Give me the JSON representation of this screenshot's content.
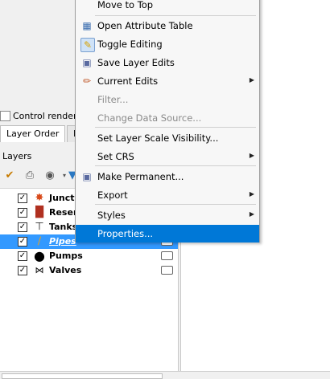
{
  "layers_panel": {
    "control_rendering_label": "Control renderin",
    "tabs": [
      {
        "label": "Layer Order"
      },
      {
        "label": "I"
      }
    ],
    "title": "Layers",
    "layers": [
      {
        "name": "Junct",
        "checked": true,
        "icon": "junction-icon",
        "selected": false
      },
      {
        "name": "Reser",
        "checked": true,
        "icon": "reservoir-icon",
        "selected": false
      },
      {
        "name": "Tanks",
        "checked": true,
        "icon": "tank-icon",
        "selected": false
      },
      {
        "name": "Pipes",
        "checked": true,
        "icon": "pipe-icon",
        "selected": true
      },
      {
        "name": "Pumps",
        "checked": true,
        "icon": "pump-icon",
        "selected": false
      },
      {
        "name": "Valves",
        "checked": true,
        "icon": "valve-icon",
        "selected": false
      }
    ]
  },
  "context_menu": {
    "items": [
      {
        "label": "Move to Top",
        "icon": "",
        "disabled": false,
        "submenu": false
      },
      {
        "label": "Open Attribute Table",
        "icon": "table-icon",
        "disabled": false,
        "submenu": false
      },
      {
        "label": "Toggle Editing",
        "icon": "pencil-icon",
        "disabled": false,
        "submenu": false
      },
      {
        "label": "Save Layer Edits",
        "icon": "save-edits-icon",
        "disabled": false,
        "submenu": false
      },
      {
        "label": "Current Edits",
        "icon": "current-edits-icon",
        "disabled": false,
        "submenu": true
      },
      {
        "label": "Filter...",
        "icon": "",
        "disabled": true,
        "submenu": false
      },
      {
        "label": "Change Data Source...",
        "icon": "",
        "disabled": true,
        "submenu": false
      },
      {
        "label": "Set Layer Scale Visibility...",
        "icon": "",
        "disabled": false,
        "submenu": false
      },
      {
        "label": "Set CRS",
        "icon": "",
        "disabled": false,
        "submenu": true
      },
      {
        "label": "Make Permanent...",
        "icon": "save-icon",
        "disabled": false,
        "submenu": false
      },
      {
        "label": "Export",
        "icon": "",
        "disabled": false,
        "submenu": true
      },
      {
        "label": "Styles",
        "icon": "",
        "disabled": false,
        "submenu": true
      },
      {
        "label": "Properties...",
        "icon": "",
        "disabled": false,
        "submenu": false,
        "highlighted": true
      }
    ]
  },
  "colors": {
    "selection": "#3399ff",
    "menu_highlight": "#0078d7",
    "disabled_text": "#8a8a8a"
  }
}
